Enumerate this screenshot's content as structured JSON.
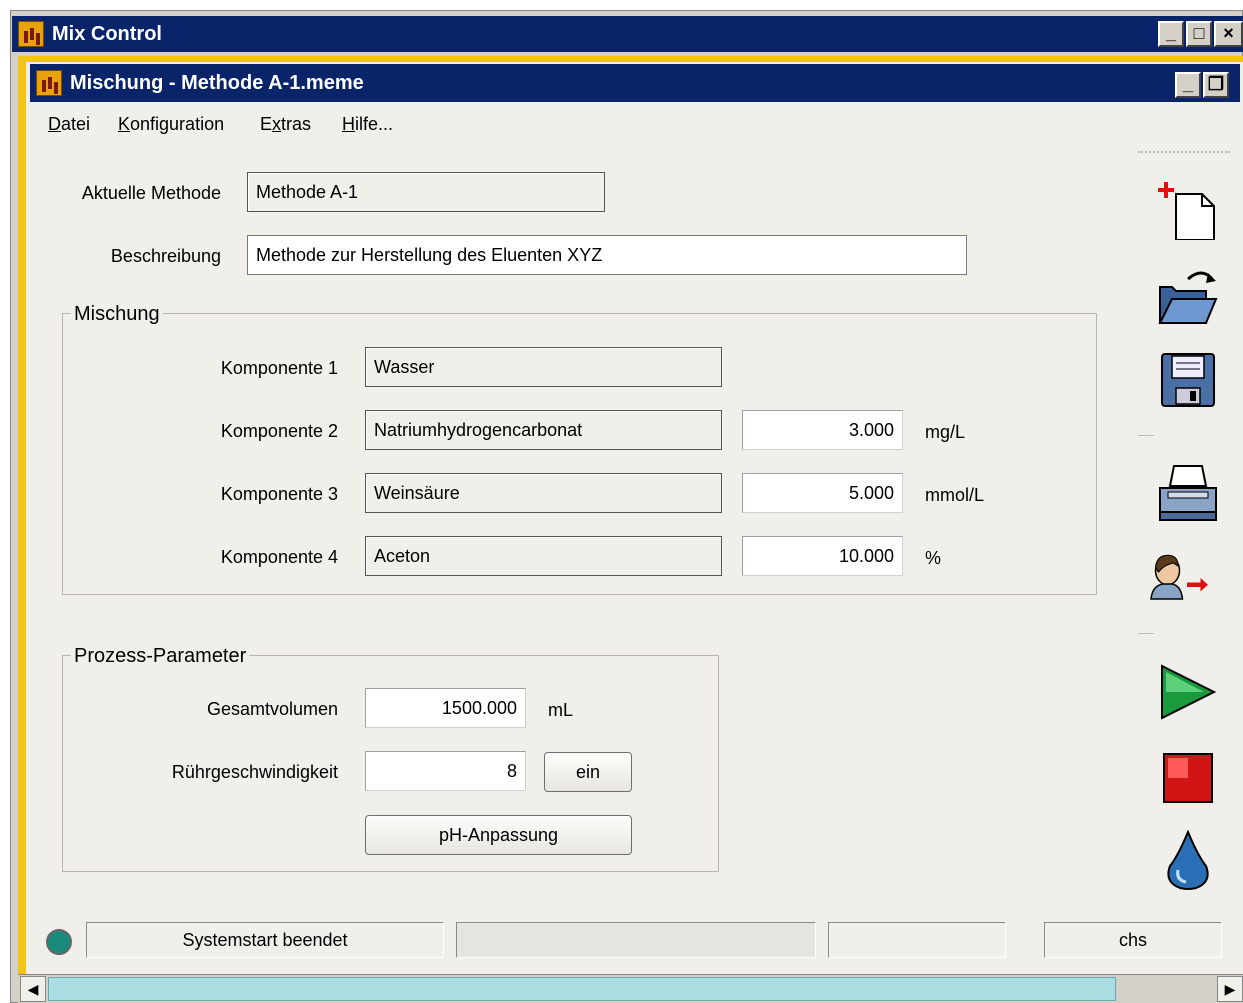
{
  "outer_window": {
    "title": "Mix Control"
  },
  "inner_window": {
    "title": "Mischung - Methode A-1.meme"
  },
  "menu": {
    "items": [
      {
        "first": "D",
        "rest": "atei"
      },
      {
        "first": "K",
        "rest": "onfiguration"
      },
      {
        "first": "E",
        "pre": "",
        "mid": "x",
        "rest": "tras"
      },
      {
        "first": "H",
        "rest": "ilfe..."
      }
    ],
    "labels": [
      "Datei",
      "Konfiguration",
      "Extras",
      "Hilfe..."
    ]
  },
  "method": {
    "current_label": "Aktuelle Methode",
    "current_value": "Methode A-1",
    "description_label": "Beschreibung",
    "description_value": "Methode zur Herstellung des Eluenten XYZ"
  },
  "mixture": {
    "legend": "Mischung",
    "components": [
      {
        "label": "Komponente 1",
        "name": "Wasser",
        "amount": "",
        "unit": ""
      },
      {
        "label": "Komponente 2",
        "name": "Natriumhydrogencarbonat",
        "amount": "3.000",
        "unit": "mg/L"
      },
      {
        "label": "Komponente 3",
        "name": "Weinsäure",
        "amount": "5.000",
        "unit": "mmol/L"
      },
      {
        "label": "Komponente 4",
        "name": "Aceton",
        "amount": "10.000",
        "unit": "%"
      }
    ]
  },
  "process": {
    "legend": "Prozess-Parameter",
    "total_volume_label": "Gesamtvolumen",
    "total_volume_value": "1500.000",
    "total_volume_unit": "mL",
    "stir_label": "Rührgeschwindigkeit",
    "stir_value": "8",
    "stir_button": "ein",
    "ph_button": "pH-Anpassung"
  },
  "status": {
    "message": "Systemstart beendet",
    "panel2": "",
    "panel3": "",
    "user": "chs"
  },
  "colors": {
    "titlebar": "#0a246a",
    "frame_accent": "#f3c51a",
    "play": "#1a9a3a",
    "stop": "#d21414",
    "drop": "#2a6fb5",
    "status_led": "#1a8a7a"
  }
}
